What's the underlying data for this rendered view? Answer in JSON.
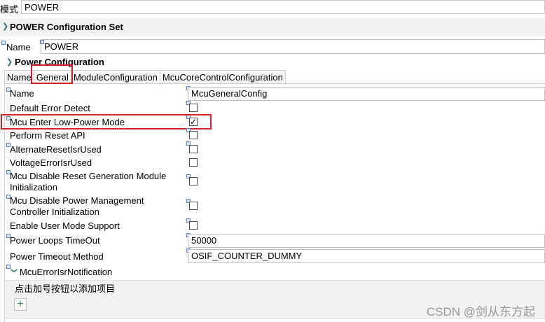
{
  "top": {
    "mode_label": "模式",
    "mode_value": "POWER"
  },
  "section": {
    "title": "POWER Configuration Set"
  },
  "name_field": {
    "label": "Name",
    "value": "POWER"
  },
  "power_config": {
    "title": "Power Configuration",
    "tabs": [
      {
        "label": "Name"
      },
      {
        "label": "General"
      },
      {
        "label": "ModuleConfiguration"
      },
      {
        "label": "McuCoreControlConfiguration"
      }
    ],
    "active_tab": "General"
  },
  "general": {
    "name": {
      "label": "Name",
      "value": "McuGeneralConfig"
    },
    "default_error_detect": {
      "label": "Default Error Detect",
      "checked": false
    },
    "mcu_enter_low_power": {
      "label": "Mcu Enter Low-Power Mode",
      "checked": true,
      "check_glyph": "✓"
    },
    "perform_reset_api": {
      "label": "Perform Reset API",
      "checked": false
    },
    "alternate_reset": {
      "label": "AlternateResetIsrUsed",
      "checked": false
    },
    "voltage_error": {
      "label": "VoltageErrorIsrUsed",
      "checked": false
    },
    "disable_reset_gen": {
      "label_line1": "Mcu Disable Reset Generation Module",
      "label_line2": "Initialization",
      "checked": false
    },
    "disable_pmc": {
      "label_line1": "Mcu Disable Power Management",
      "label_line2": "Controller Initialization",
      "checked": false
    },
    "enable_user_mode": {
      "label": "Enable User Mode Support",
      "checked": false
    },
    "power_loops_timeout": {
      "label": "Power Loops TimeOut",
      "value": "50000"
    },
    "power_timeout_method": {
      "label": "Power Timeout Method",
      "value": "OSIF_COUNTER_DUMMY"
    },
    "mcu_error_isr": {
      "label": "McuErrorIsrNotification"
    }
  },
  "notification_panel": {
    "hint": "点击加号按钮以添加项目",
    "add_glyph": "+"
  },
  "watermark": "CSDN @剑从东方起",
  "colors": {
    "highlight_red": "#d4242b",
    "accent_teal": "#2f7a75"
  }
}
